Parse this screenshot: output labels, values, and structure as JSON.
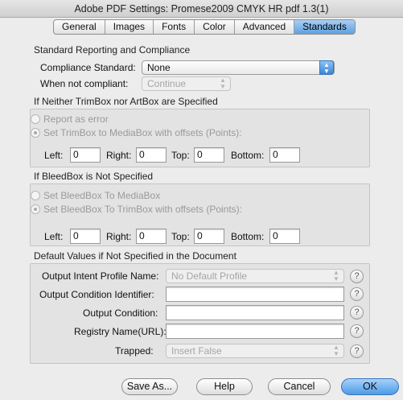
{
  "window": {
    "title": "Adobe PDF Settings: Promese2009 CMYK HR pdf 1.3(1)"
  },
  "tabs": [
    {
      "label": "General"
    },
    {
      "label": "Images"
    },
    {
      "label": "Fonts"
    },
    {
      "label": "Color"
    },
    {
      "label": "Advanced"
    },
    {
      "label": "Standards",
      "active": true
    }
  ],
  "standards": {
    "section_title": "Standard Reporting and Compliance",
    "compliance_label": "Compliance Standard:",
    "compliance_value": "None",
    "not_compliant_label": "When not compliant:",
    "not_compliant_value": "Continue"
  },
  "trimbox": {
    "title": "If Neither TrimBox nor ArtBox are Specified",
    "option_report": "Report as error",
    "option_set": "Set TrimBox to MediaBox with offsets (Points):",
    "left_label": "Left:",
    "left_value": "0",
    "right_label": "Right:",
    "right_value": "0",
    "top_label": "Top:",
    "top_value": "0",
    "bottom_label": "Bottom:",
    "bottom_value": "0"
  },
  "bleedbox": {
    "title": "If BleedBox is Not Specified",
    "option_media": "Set BleedBox To MediaBox",
    "option_trim": "Set BleedBox To TrimBox with offsets (Points):",
    "left_label": "Left:",
    "left_value": "0",
    "right_label": "Right:",
    "right_value": "0",
    "top_label": "Top:",
    "top_value": "0",
    "bottom_label": "Bottom:",
    "bottom_value": "0"
  },
  "defaults": {
    "title": "Default Values if Not Specified in the Document",
    "profile_label": "Output Intent Profile Name:",
    "profile_value": "No Default Profile",
    "condition_id_label": "Output Condition Identifier:",
    "condition_id_value": "",
    "condition_label": "Output Condition:",
    "condition_value": "",
    "registry_label": "Registry Name(URL):",
    "registry_value": "",
    "trapped_label": "Trapped:",
    "trapped_value": "Insert False",
    "help_glyph": "?"
  },
  "buttons": {
    "save_as": "Save As...",
    "help": "Help",
    "cancel": "Cancel",
    "ok": "OK"
  }
}
